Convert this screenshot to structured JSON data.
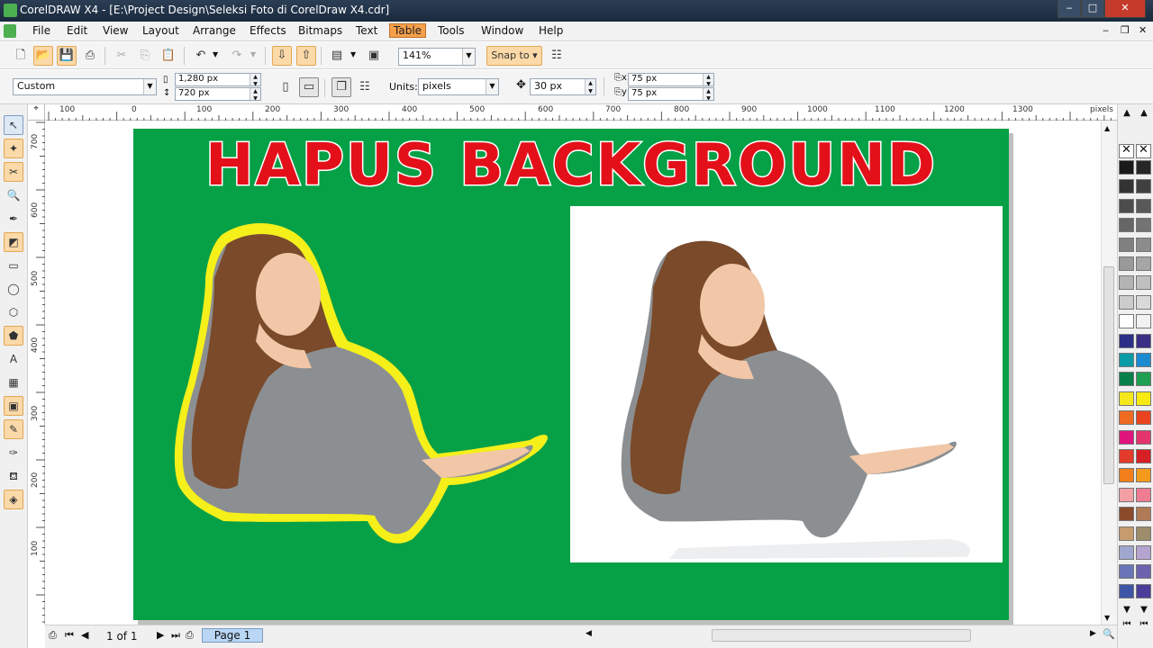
{
  "titlebar": {
    "title": "CorelDRAW X4 - [E:\\Project Design\\Seleksi Foto di CorelDraw X4.cdr]"
  },
  "menu": [
    "File",
    "Edit",
    "View",
    "Layout",
    "Arrange",
    "Effects",
    "Bitmaps",
    "Text",
    "Table",
    "Tools",
    "Window",
    "Help"
  ],
  "menu_active": "Table",
  "toolbar": {
    "zoom": "141%",
    "snap_to": "Snap to"
  },
  "property_bar": {
    "preset": "Custom",
    "width": "1,280 px",
    "height": "720 px",
    "units_label": "Units:",
    "units": "pixels",
    "nudge": "30 px",
    "dup_x": "75 px",
    "dup_y": "75 px"
  },
  "ruler": {
    "h_labels": [
      "100",
      "0",
      "100",
      "200",
      "300",
      "400",
      "500",
      "600",
      "700",
      "800",
      "900",
      "1000",
      "1100",
      "1200",
      "1300"
    ],
    "units": "pixels",
    "v_labels": [
      "700",
      "600",
      "500",
      "400",
      "300",
      "200",
      "100"
    ]
  },
  "canvas": {
    "headline": "HAPUS BACKGROUND",
    "background_color": "#06a046",
    "headline_color": "#e3101a",
    "outline_color": "#f5ef1a"
  },
  "status": {
    "page_count": "1 of 1",
    "page_tab": "Page 1"
  },
  "palette": {
    "col1": [
      "#1a1a1a",
      "#333333",
      "#4d4d4d",
      "#666666",
      "#808080",
      "#999999",
      "#b3b3b3",
      "#cccccc",
      "#ffffff",
      "#2b2f86",
      "#0a9ba6",
      "#08804a",
      "#f4e71b",
      "#ef6b22",
      "#e0147d",
      "#e23a2b",
      "#f27f1b",
      "#f3a0a4",
      "#8a4a2c",
      "#c69b6d",
      "#9fa7cf",
      "#6a75b8",
      "#3d55a4",
      "#1f3e91",
      "#2b3a7a",
      "#2a5aa8",
      "#4b79c0",
      "#2c4187",
      "#253870"
    ],
    "col2": [
      "#262626",
      "#404040",
      "#595959",
      "#737373",
      "#8c8c8c",
      "#a6a6a6",
      "#bfbfbf",
      "#d9d9d9",
      "#f2f2f2",
      "#3a2f86",
      "#1c8ad0",
      "#1e9f52",
      "#f6ea11",
      "#e9441f",
      "#e4346c",
      "#d71f26",
      "#f39a1c",
      "#ef7c91",
      "#b07a57",
      "#9c8c6b",
      "#b6a4d0",
      "#6b62b0",
      "#4b3e9a",
      "#3f4da1",
      "#2f4f9e",
      "#3d6ab3",
      "#6f92cf",
      "#3a4c9a",
      "#2b3b7e"
    ]
  }
}
